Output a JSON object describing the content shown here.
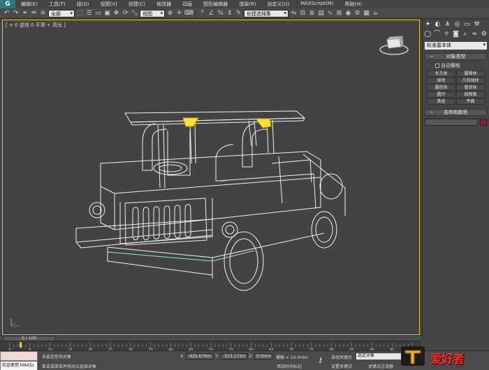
{
  "menu": {
    "logo": "G",
    "items": [
      "编辑(E)",
      "工具(T)",
      "组(G)",
      "视图(V)",
      "创建(C)",
      "修改器",
      "动画",
      "图形编辑器",
      "渲染(R)",
      "自定义(U)",
      "MAXScript(M)",
      "帮助(H)"
    ]
  },
  "toolbar": {
    "selection_filter": "全部",
    "ref_coord": "视图",
    "named_selection": "创建选择集"
  },
  "viewport": {
    "label": "[ + 0 透视 0 平滑 + 高光 ]"
  },
  "command_panel": {
    "category": "标准基本体",
    "object_type_title": "对象类型",
    "autogrid_label": "自动栅格",
    "objects": [
      "长方体",
      "圆锥体",
      "球体",
      "几何球体",
      "圆柱体",
      "管状体",
      "圆环",
      "四棱锥",
      "茶壶",
      "平面"
    ],
    "name_color_title": "名称和颜色",
    "object_color": "#8e1b3c"
  },
  "timeline": {
    "frame_readout": "0 / 100",
    "tick_labels": [
      "0",
      "5",
      "10",
      "15",
      "20",
      "25",
      "30",
      "35",
      "40",
      "45",
      "50",
      "55",
      "60",
      "65",
      "70",
      "75",
      "80",
      "85",
      "90",
      "95",
      "100"
    ]
  },
  "status": {
    "maxscript_text": "欢迎使用 MAXSc",
    "selection_text": "未选定任何对象",
    "prompt_text": "单击或单击并拖动以选择对象",
    "x_label": "X:",
    "x_value": "-925.679m",
    "y_label": "Y:",
    "y_value": "-313.173m",
    "z_label": "Z:",
    "z_value": "0.0mm",
    "grid_text": "栅格 = 10.0mm",
    "add_time_tag": "添加时间标记",
    "auto_key": "自动关键点",
    "set_key": "设置关键点",
    "selection_set": "选定对象",
    "key_filters": "关键点过滤器"
  },
  "watermark": {
    "text": "爱好者"
  }
}
